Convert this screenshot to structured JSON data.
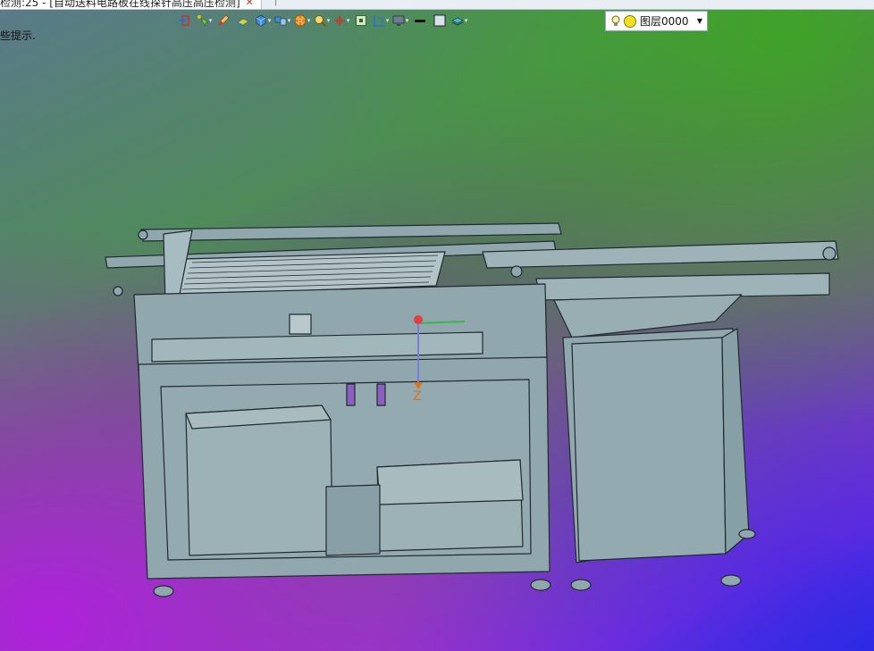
{
  "document_tab": {
    "title": "检测:25 - [自动送料电路板在线探针高压高压检测]",
    "close_icon": "close-icon",
    "add_icon": "plus-icon"
  },
  "toolbar": {
    "buttons": [
      {
        "name": "exit-sketch-button",
        "icon": "exit-icon"
      },
      {
        "name": "pointer-button",
        "icon": "pointer-icon"
      },
      {
        "name": "pencil-button",
        "icon": "pencil-icon"
      },
      {
        "name": "face-button",
        "icon": "face-icon"
      },
      {
        "name": "box-button",
        "icon": "cube-icon"
      },
      {
        "name": "view-orient-button",
        "icon": "views-icon"
      },
      {
        "name": "render-button",
        "icon": "render-wheel-icon"
      },
      {
        "name": "zoom-button",
        "icon": "zoom-icon"
      },
      {
        "name": "triad-button",
        "icon": "triad-icon"
      },
      {
        "name": "fit-button",
        "icon": "fit-icon"
      },
      {
        "name": "section-button",
        "icon": "section-icon"
      },
      {
        "name": "display-button",
        "icon": "monitor-icon"
      },
      {
        "name": "line-style-button",
        "icon": "line-icon"
      },
      {
        "name": "fill-button",
        "icon": "square-icon"
      },
      {
        "name": "layer-button",
        "icon": "layers-icon"
      }
    ]
  },
  "layer_select": {
    "value": "图层0000",
    "bulb_icon": "bulb-icon",
    "sun_icon": "sun-icon",
    "arrow_icon": "dropdown-arrow-icon"
  },
  "hint_text": "些提示.",
  "axis": {
    "z_label": "Z"
  },
  "colors": {
    "model_fill": "#8fa7ad",
    "model_stroke": "#1f2a2e"
  }
}
